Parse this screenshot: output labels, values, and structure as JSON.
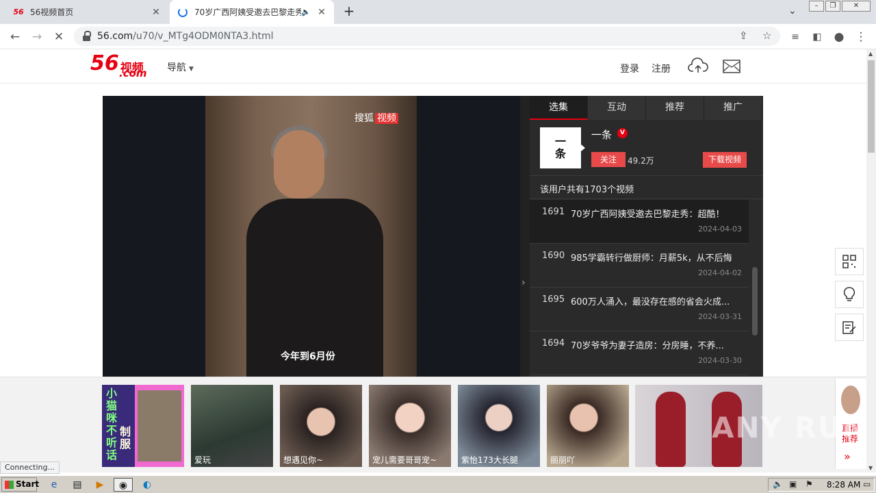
{
  "browser": {
    "tabs": [
      {
        "favicon": "56",
        "title": "56视频首页",
        "active": false
      },
      {
        "title": "70岁广西阿姨受邀去巴黎走秀",
        "active": true
      }
    ],
    "url_domain": "56.com",
    "url_path": "/u70/v_MTg4ODM0NTA3.html",
    "status_text": "Connecting..."
  },
  "site": {
    "logo_num": "56",
    "logo_text": "视频",
    "logo_domain": ".com",
    "nav_label": "导航",
    "login_label": "登录",
    "register_label": "注册"
  },
  "player": {
    "watermark_brand": "搜狐",
    "watermark_tag": "视频",
    "subtitle": "今年到6月份"
  },
  "panel": {
    "tabs": [
      "选集",
      "互动",
      "推荐",
      "推广"
    ],
    "author": {
      "logo_line1": "一",
      "logo_line2": "条",
      "name": "一条",
      "follow_label": "关注",
      "fans": "49.2万",
      "download_label": "下载视频"
    },
    "video_count_text": "该用户共有1703个视频",
    "videos": [
      {
        "num": "1691",
        "title": "70岁广西阿姨受邀去巴黎走秀：超酷！",
        "date": "2024-04-03",
        "active": true
      },
      {
        "num": "1690",
        "title": "985学霸转行做厨师：月薪5k，从不后悔",
        "date": "2024-04-02",
        "active": false
      },
      {
        "num": "1695",
        "title": "600万人涌入，最没存在感的省会火成...",
        "date": "2024-03-31",
        "active": false
      },
      {
        "num": "1694",
        "title": "70岁爷爷为妻子造房：分房睡，不养...",
        "date": "2024-03-30",
        "active": false
      }
    ]
  },
  "ads": {
    "first_text_a": "小猫咪不听话",
    "first_text_b": "制服",
    "items": [
      {
        "caption": "爱玩"
      },
      {
        "caption": "想遇见你~"
      },
      {
        "caption": "宠儿需要哥哥宠~"
      },
      {
        "caption": "紫怡173大长腿"
      },
      {
        "caption": "丽丽吖"
      }
    ],
    "live_label": "直播推荐",
    "live_arrow": "»"
  },
  "watermark_overlay": "ANY RUN",
  "taskbar": {
    "start_label": "Start",
    "clock": "8:28 AM"
  },
  "colors": {
    "brand_red": "#e60012",
    "panel_bg": "#2a2a2a",
    "button_red": "#e84a4a"
  }
}
